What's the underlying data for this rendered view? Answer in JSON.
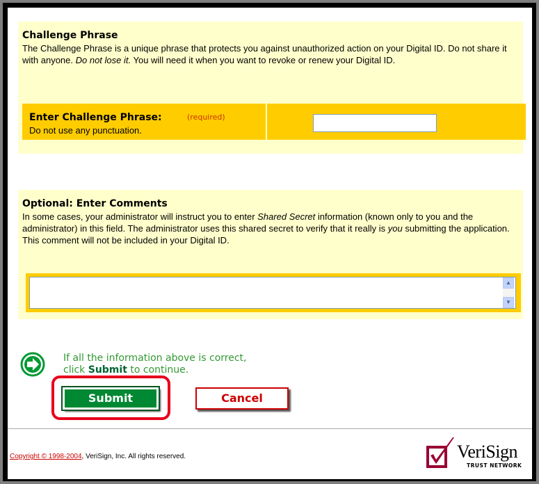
{
  "challenge": {
    "title": "Challenge Phrase",
    "description_1": "The Challenge Phrase is a unique phrase that protects you against unauthorized action on your Digital ID. Do not share it with anyone. ",
    "description_em": "Do not lose it.",
    "description_2": " You will need it when you want to revoke or renew your Digital ID.",
    "field_label": "Enter Challenge Phrase:",
    "required_note": "(required)",
    "field_hint": "Do not use any punctuation.",
    "input_value": ""
  },
  "comments": {
    "title": "Optional: Enter Comments",
    "desc_1": "In some cases, your administrator will instruct you to enter ",
    "desc_em1": "Shared Secret",
    "desc_2": " information (known only to you and the administrator) in this field. The administrator uses this shared secret to verify that it really is ",
    "desc_em2": "you",
    "desc_3": " submitting the application. This comment will not be included in your Digital ID.",
    "textarea_value": ""
  },
  "proceed": {
    "line1": "If all the information above is correct,",
    "line2_pre": "click ",
    "line2_bold": "Submit",
    "line2_post": " to continue."
  },
  "buttons": {
    "submit": "Submit",
    "cancel": "Cancel"
  },
  "footer": {
    "copyright_link": "Copyright © 1998-2004",
    "copyright_rest": ", VeriSign, Inc. All rights reserved."
  },
  "logo": {
    "name": "VeriSign",
    "tagline": "TRUST NETWORK"
  },
  "icons": {
    "go": "right-arrow-circle-icon",
    "scroll_up": "scroll-up-icon",
    "scroll_down": "scroll-down-icon",
    "logo_check": "checkmark-logo-icon"
  },
  "colors": {
    "section_bg": "#ffffcc",
    "field_bg": "#ffcc00",
    "go_green": "#009933",
    "highlight": "#e8001c",
    "cancel_red": "#cc0000"
  }
}
